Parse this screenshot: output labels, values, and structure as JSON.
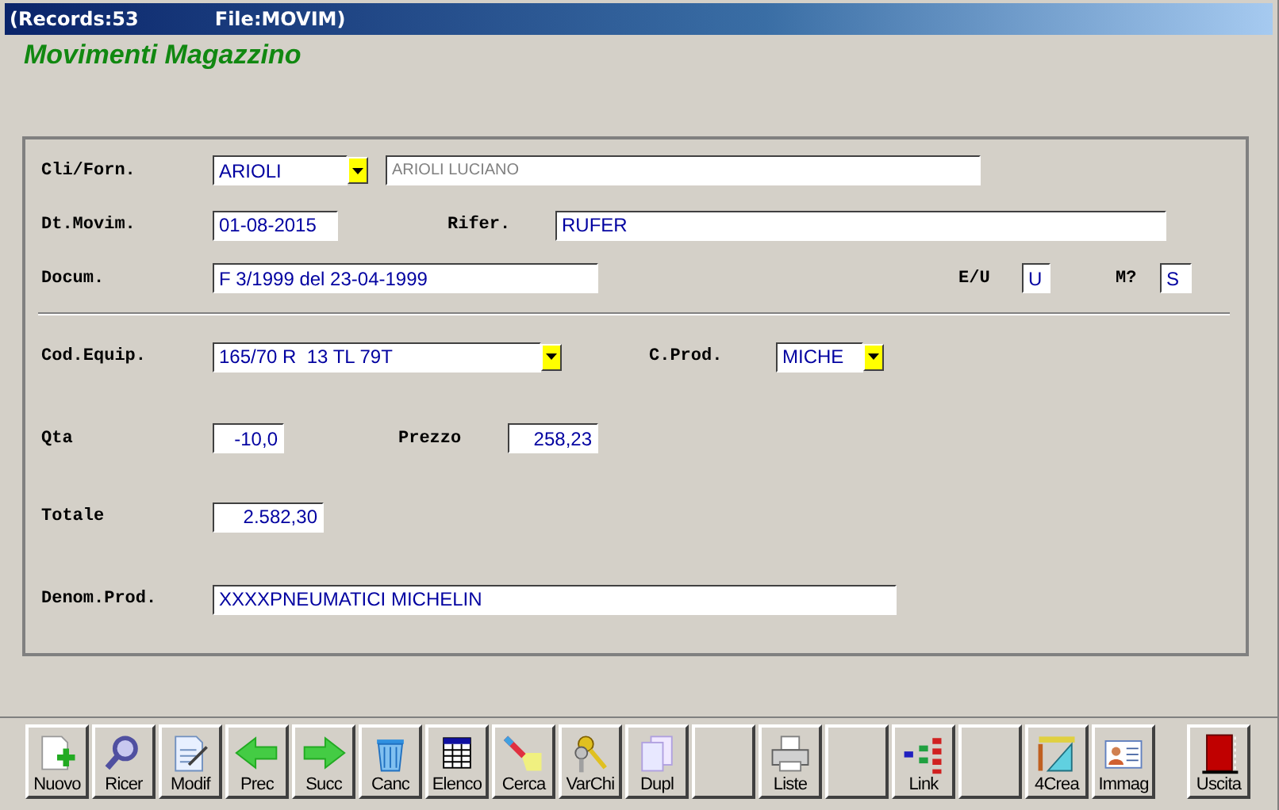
{
  "window": {
    "title_parts": [
      "(Records:53",
      "File:MOVIM)"
    ]
  },
  "heading": "Movimenti Magazzino",
  "form": {
    "cli_forn": {
      "label": "Cli/Forn.",
      "value": "ARIOLI",
      "name": "ARIOLI LUCIANO"
    },
    "dt_movim": {
      "label": "Dt.Movim.",
      "value": "01-08-2015"
    },
    "rifer": {
      "label": "Rifer.",
      "value": "RUFER"
    },
    "docum": {
      "label": "Docum.",
      "value": "F 3/1999 del 23-04-1999"
    },
    "e_u": {
      "label": "E/U",
      "value": "U"
    },
    "m": {
      "label": "M?",
      "value": "S"
    },
    "cod_equip": {
      "label": "Cod.Equip.",
      "value": "165/70 R  13 TL 79T"
    },
    "c_prod": {
      "label": "C.Prod.",
      "value": "MICHE"
    },
    "qta": {
      "label": "Qta",
      "value": "-10,0"
    },
    "prezzo": {
      "label": "Prezzo",
      "value": "258,23"
    },
    "totale": {
      "label": "Totale",
      "value": "2.582,30"
    },
    "denom_prod": {
      "label": "Denom.Prod.",
      "value": "XXXXPNEUMATICI MICHELIN"
    }
  },
  "toolbar": [
    {
      "kind": "action",
      "label": "Nuovo"
    },
    {
      "kind": "action",
      "label": "Ricer"
    },
    {
      "kind": "action",
      "label": "Modif"
    },
    {
      "kind": "action",
      "label": "Prec"
    },
    {
      "kind": "action",
      "label": "Succ"
    },
    {
      "kind": "action",
      "label": "Canc"
    },
    {
      "kind": "action",
      "label": "Elenco"
    },
    {
      "kind": "action",
      "label": "Cerca"
    },
    {
      "kind": "action",
      "label": "VarChi"
    },
    {
      "kind": "action",
      "label": "Dupl"
    },
    {
      "kind": "empty"
    },
    {
      "kind": "action",
      "label": "Liste"
    },
    {
      "kind": "empty"
    },
    {
      "kind": "action",
      "label": "Link"
    },
    {
      "kind": "empty"
    },
    {
      "kind": "action",
      "label": "4Crea"
    },
    {
      "kind": "action",
      "label": "Immag"
    },
    {
      "kind": "exit",
      "label": "Uscita"
    }
  ]
}
